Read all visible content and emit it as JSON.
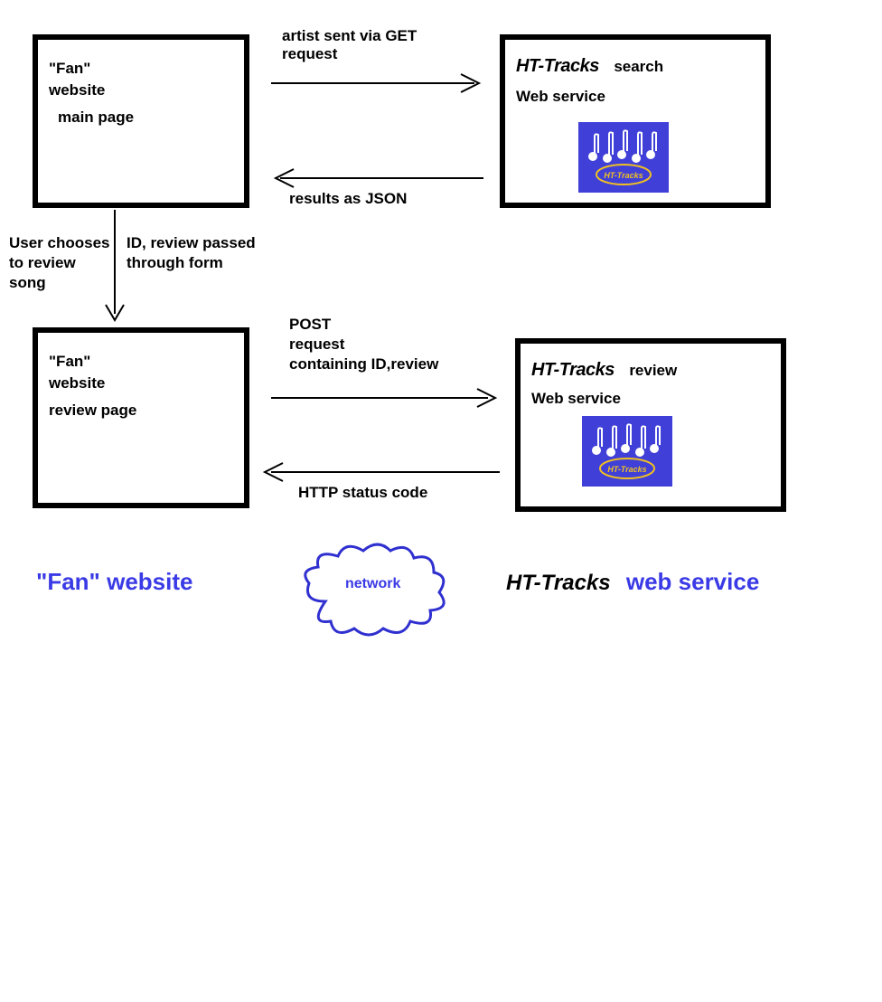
{
  "boxes": {
    "fanMain": {
      "l1": "\"Fan\"",
      "l2": "website",
      "l3": "main page"
    },
    "fanReview": {
      "l1": "\"Fan\"",
      "l2": "website",
      "l3": "review page"
    },
    "htSearch": {
      "brand": "HT-Tracks",
      "role": "search",
      "sub": "Web service"
    },
    "htReview": {
      "brand": "HT-Tracks",
      "role": "review",
      "sub": "Web service"
    }
  },
  "arrows": {
    "getReq": "artist sent via GET\nrequest",
    "jsonRes": "results as JSON",
    "userChoose": "User chooses\nto review\nsong",
    "formPass": "ID, review passed\nthrough form",
    "postReq": "POST\nrequest\ncontaining ID,review",
    "statusCode": "HTTP status code"
  },
  "legend": {
    "fan": "\"Fan\" website",
    "htBrand": "HT-Tracks",
    "htRest": "web service",
    "cloud": "network"
  },
  "logoBadge": "HT-Tracks"
}
